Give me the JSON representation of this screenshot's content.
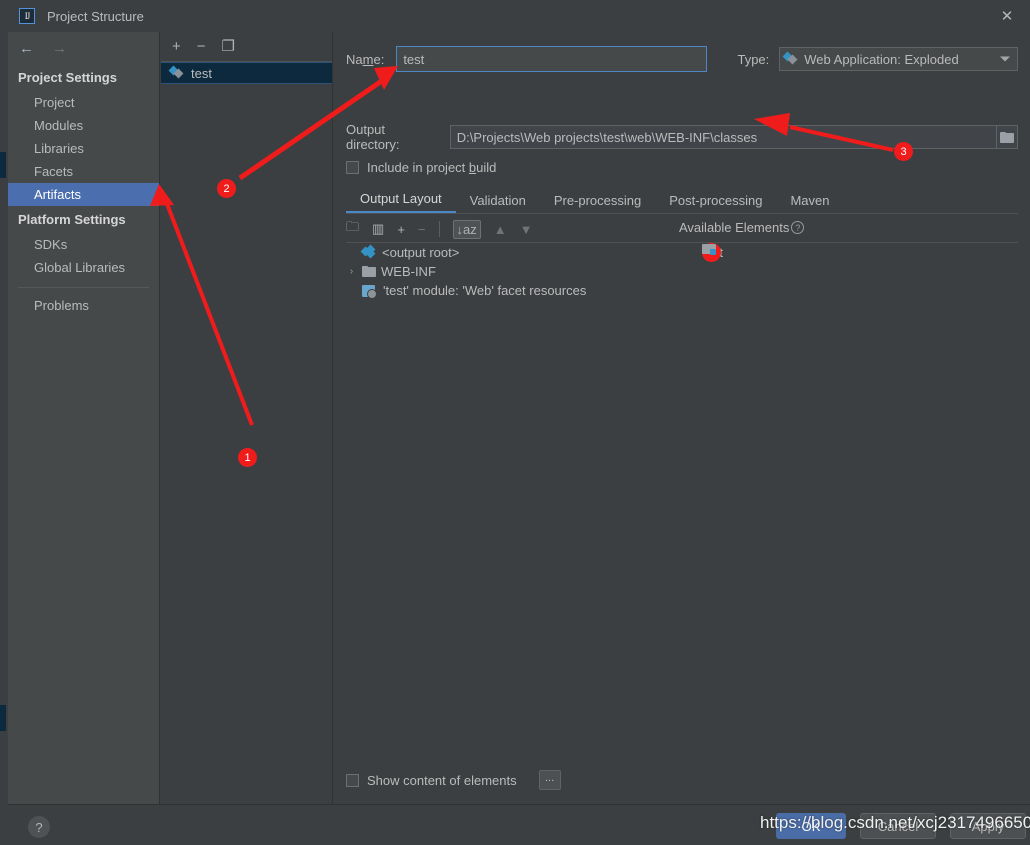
{
  "window": {
    "title": "Project Structure",
    "app_icon": "IJ",
    "close_icon": "✕"
  },
  "sidebar": {
    "back_icon": "←",
    "forward_icon": "→",
    "groups": [
      {
        "title": "Project Settings",
        "items": [
          {
            "label": "Project",
            "selected": false
          },
          {
            "label": "Modules",
            "selected": false
          },
          {
            "label": "Libraries",
            "selected": false
          },
          {
            "label": "Facets",
            "selected": false
          },
          {
            "label": "Artifacts",
            "selected": true
          }
        ]
      },
      {
        "title": "Platform Settings",
        "items": [
          {
            "label": "SDKs",
            "selected": false
          },
          {
            "label": "Global Libraries",
            "selected": false
          }
        ]
      }
    ],
    "problems_label": "Problems"
  },
  "artifact_list": {
    "toolbar": [
      {
        "name": "add-artifact-button",
        "glyph": "+"
      },
      {
        "name": "remove-artifact-button",
        "glyph": "−"
      },
      {
        "name": "copy-artifact-button",
        "glyph": "❐"
      }
    ],
    "items": [
      {
        "label": "test",
        "icon": "artifact-icon",
        "selected": true
      }
    ]
  },
  "details": {
    "name_label": "Na",
    "name_label_mnemonic": "m",
    "name_label_tail": "e:",
    "name_value": "test",
    "name_placeholder": "",
    "type_label": "Type:",
    "type_value": "Web Application: Exploded",
    "output_dir_label": "Output directory:",
    "output_dir_value": "D:\\Projects\\Web projects\\test\\web\\WEB-INF\\classes",
    "include_label_head": "Include in project ",
    "include_label_mnemonic": "b",
    "include_label_tail": "uild",
    "include_checked": false,
    "tabs": [
      {
        "label": "Output Layout",
        "active": true
      },
      {
        "label": "Validation",
        "active": false
      },
      {
        "label": "Pre-processing",
        "active": false
      },
      {
        "label": "Post-processing",
        "active": false
      },
      {
        "label": "Maven",
        "active": false
      }
    ],
    "layout_toolbar": [
      {
        "name": "add-directory-icon",
        "glyph": "🗀"
      },
      {
        "name": "add-archive-icon",
        "glyph": "▥"
      },
      {
        "name": "add-copy-icon",
        "glyph": "+"
      },
      {
        "name": "remove-element-icon",
        "glyph": "−"
      },
      {
        "name": "sort-icon",
        "glyph": "↓az"
      },
      {
        "name": "move-up-icon",
        "glyph": "▲"
      },
      {
        "name": "move-down-icon",
        "glyph": "▼"
      }
    ],
    "available_elements_label": "Available Elements",
    "available_elements_help": "?",
    "tree": [
      {
        "label": "<output root>",
        "icon": "output-root-icon",
        "toggle": "",
        "indent": 0
      },
      {
        "label": "WEB-INF",
        "icon": "folder-icon",
        "toggle": "›",
        "indent": 0
      },
      {
        "label": "'test' module: 'Web' facet resources",
        "icon": "facet-icon",
        "toggle": "",
        "indent": 1
      }
    ],
    "available_elements": [
      {
        "label": "test",
        "icon": "module-folder-icon"
      }
    ],
    "show_content_label": "Show content of elements",
    "show_content_checked": false,
    "dots_button_label": "..."
  },
  "footer": {
    "help_label": "?",
    "buttons": [
      {
        "name": "ok-button",
        "label": "OK",
        "primary": true
      },
      {
        "name": "cancel-button",
        "label": "Cancel",
        "primary": false
      },
      {
        "name": "apply-button",
        "label": "Apply",
        "primary": false
      }
    ]
  },
  "annotations": {
    "badges": [
      {
        "id": "1",
        "label": "1"
      },
      {
        "id": "2",
        "label": "2"
      },
      {
        "id": "3",
        "label": "3"
      }
    ],
    "arrow_color": "#f01c1c",
    "watermark": "https://blog.csdn.net/xcj2317496650"
  }
}
